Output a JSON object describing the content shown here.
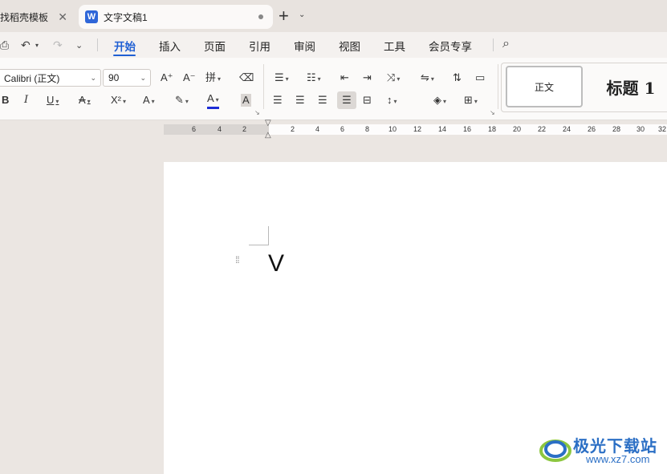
{
  "tabs": [
    {
      "label": "找稻壳模板",
      "active": false
    },
    {
      "label": "文字文稿1",
      "active": true,
      "icon_letter": "W"
    }
  ],
  "menu": {
    "items": [
      "开始",
      "插入",
      "页面",
      "引用",
      "审阅",
      "视图",
      "工具",
      "会员专享"
    ],
    "active": "开始"
  },
  "font": {
    "name": "Calibri (正文)",
    "size": "90"
  },
  "toolbar": {
    "bold": "B",
    "italic": "I",
    "underline": "U",
    "strike": "A",
    "superscript": "X²",
    "text_effect": "A",
    "font_color": "A",
    "char_shading": "A",
    "grow_font": "A⁺",
    "shrink_font": "A⁻",
    "phonetic": "拼"
  },
  "styles": {
    "normal": "正文",
    "heading1": "标题 1"
  },
  "ruler": {
    "left_numbers": [
      "6",
      "4",
      "2"
    ],
    "right_numbers": [
      "2",
      "4",
      "6",
      "8",
      "10",
      "12",
      "14",
      "16",
      "18",
      "20",
      "22",
      "24",
      "26",
      "28",
      "30",
      "32"
    ]
  },
  "document": {
    "text": "V"
  },
  "watermark": {
    "title": "极光下载站",
    "url": "www.xz7.com"
  },
  "colors": {
    "accent": "#1f5fd3",
    "word_icon": "#2f66d8",
    "font_color_bar": "#1c2cd6",
    "shading_bar": "#d2b3e6"
  }
}
